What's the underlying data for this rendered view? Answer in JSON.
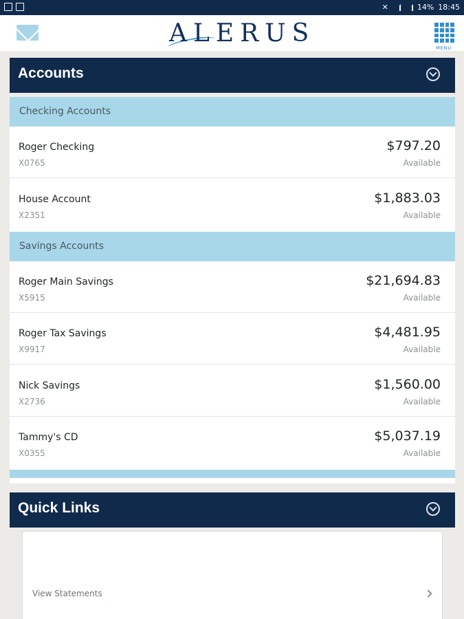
{
  "status_bar": {
    "battery": "14%",
    "time": "18:45"
  },
  "header": {
    "logo": "ALERUS",
    "menu_label": "MENU"
  },
  "accounts": {
    "title": "Accounts",
    "sections": [
      {
        "label": "Checking Accounts",
        "items": [
          {
            "name": "Roger Checking",
            "number": "X0765",
            "balance": "$797.20",
            "status": "Available"
          },
          {
            "name": "House Account",
            "number": "X2351",
            "balance": "$1,883.03",
            "status": "Available"
          }
        ]
      },
      {
        "label": "Savings Accounts",
        "items": [
          {
            "name": "Roger Main Savings",
            "number": "X5915",
            "balance": "$21,694.83",
            "status": "Available"
          },
          {
            "name": "Roger Tax Savings",
            "number": "X9917",
            "balance": "$4,481.95",
            "status": "Available"
          },
          {
            "name": "Nick Savings",
            "number": "X2736",
            "balance": "$1,560.00",
            "status": "Available"
          },
          {
            "name": "Tammy's CD",
            "number": "X0355",
            "balance": "$5,037.19",
            "status": "Available"
          }
        ]
      }
    ]
  },
  "quick_links": {
    "title": "Quick Links",
    "items": [
      {
        "label": "View Statements"
      }
    ]
  },
  "colors": {
    "navy": "#102a4c",
    "section_blue": "#a9d7ea",
    "accent_blue": "#2d8ed1"
  }
}
